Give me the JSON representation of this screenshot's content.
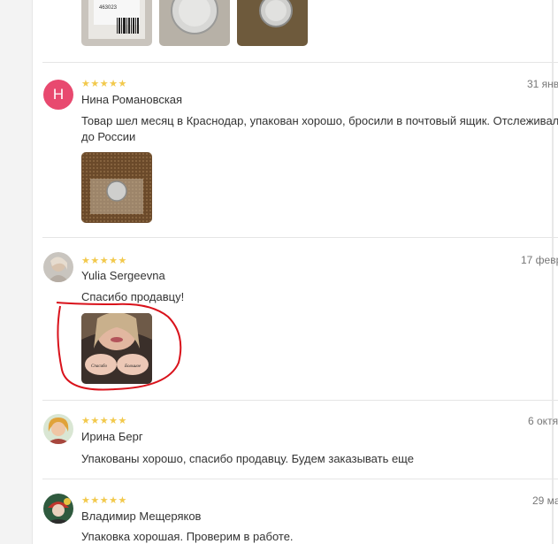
{
  "reviews": [
    {
      "stars": "★★★★★",
      "author": "",
      "date": "",
      "text": "",
      "photos": [
        {
          "name": "battery-package-photo",
          "label": "463023"
        },
        {
          "name": "battery-coin-photo",
          "label": ""
        },
        {
          "name": "battery-coin-dark-photo",
          "label": ""
        }
      ]
    },
    {
      "avatar_letter": "Н",
      "stars": "★★★★★",
      "author": "Нина Романовская",
      "date": "31 янв",
      "text_line1": "Товар шел месяц в Краснодар, упакован хорошо, бросили в почтовый ящик. Отслеживал",
      "text_line2": "до России"
    },
    {
      "stars": "★★★★★",
      "author": "Yulia Sergeevna",
      "date": "17 февр",
      "text": "Спасибо продавцу!",
      "photo_caption_left": "Спасибо",
      "photo_caption_right": "Большое"
    },
    {
      "stars": "★★★★★",
      "author": "Ирина Берг",
      "date": "6 октя",
      "text": "Упакованы хорошо, спасибо продавцу. Будем заказывать еще"
    },
    {
      "stars": "★★★★★",
      "author": "Владимир Мещеряков",
      "date": "29 ма",
      "text": "Упаковка хорошая. Проверим в работе."
    }
  ],
  "colors": {
    "star": "#f2c94c",
    "avatar_pink": "#e8496f",
    "annotation_red": "#d9121b"
  }
}
